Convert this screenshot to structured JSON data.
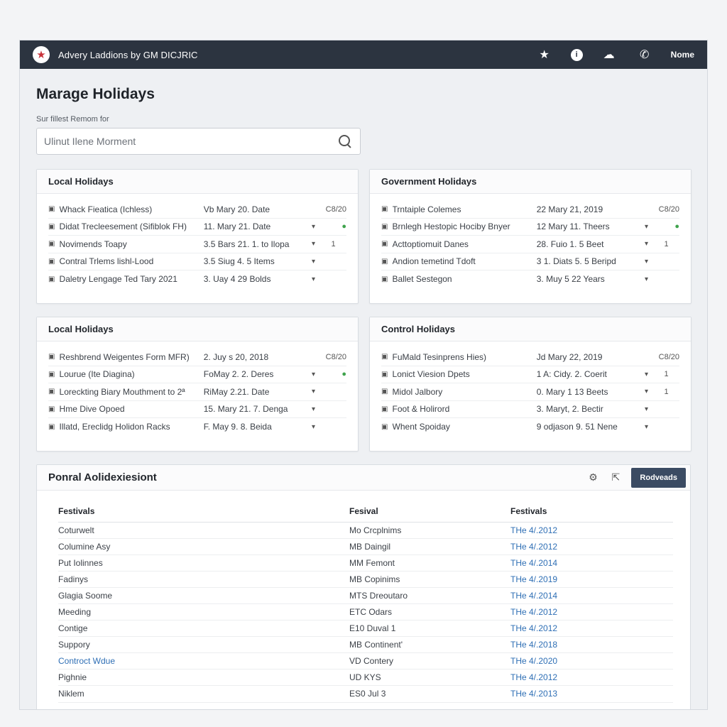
{
  "app": {
    "title": "Advery Laddions by GM DICJRIC",
    "user": "Nome"
  },
  "page": {
    "title": "Marage Holidays",
    "search_label": "Sur fillest Remom for",
    "search_placeholder": "Ulinut Ilene Morment"
  },
  "panels": [
    {
      "title": "Local Holidays",
      "rows": [
        {
          "name": "Whack Fieatica (Ichless)",
          "date": "Vb Mary 20. Date",
          "a": "",
          "b": "C8/20",
          "b_style": ""
        },
        {
          "name": "Didat Trecleesement (Sifiblok FH)",
          "date": "11. Mary 21. Date",
          "a": "▾",
          "b": "●",
          "b_style": "green"
        },
        {
          "name": "Novimends Toapy",
          "date": "3.5 Bars 21. 1. to Ilopa",
          "a": "▾",
          "b": "1",
          "b_style": "center"
        },
        {
          "name": "Contral Trlems lishl-Lood",
          "date": "3.5 Siug 4. 5 Items",
          "a": "▾",
          "b": "",
          "b_style": ""
        },
        {
          "name": "Daletry Lengage Ted Tary 2021",
          "date": "3. Uay 4 29 Bolds",
          "a": "▾",
          "b": "",
          "b_style": ""
        }
      ]
    },
    {
      "title": "Government Holidays",
      "rows": [
        {
          "name": "Trntaiple Colemes",
          "date": "22 Mary 21, 2019",
          "a": "",
          "b": "C8/20",
          "b_style": ""
        },
        {
          "name": "Brnlegh Hestopic Hociby Bnyer",
          "date": "12 Mary 11. Theers",
          "a": "▾",
          "b": "●",
          "b_style": "green"
        },
        {
          "name": "Acttoptiomuit Danes",
          "date": "28. Fuio 1. 5 Beet",
          "a": "▾",
          "b": "1",
          "b_style": "center"
        },
        {
          "name": "Andion temetind Tdoft",
          "date": "3 1. Diats 5. 5 Beripd",
          "a": "▾",
          "b": "",
          "b_style": ""
        },
        {
          "name": "Ballet Sestegon",
          "date": "3. Muy 5 22 Years",
          "a": "▾",
          "b": "",
          "b_style": ""
        }
      ]
    },
    {
      "title": "Local Holidays",
      "rows": [
        {
          "name": "Reshbrend Weigentes Form MFR)",
          "date": "2. Juy s 20, 2018",
          "a": "",
          "b": "C8/20",
          "b_style": ""
        },
        {
          "name": "Lourue (Ite Diagina)",
          "date": "FoMay 2. 2. Deres",
          "a": "▾",
          "b": "●",
          "b_style": "green"
        },
        {
          "name": "Loreckting Biary Mouthment to 2ª",
          "date": "RiMay 2.21. Date",
          "a": "▾",
          "b": "",
          "b_style": ""
        },
        {
          "name": "Hme Dive Opoed",
          "date": "15. Mary 21. 7. Denga",
          "a": "▾",
          "b": "",
          "b_style": ""
        },
        {
          "name": "Illatd, Ereclidg Holidon Racks",
          "date": "F. May 9. 8. Beida",
          "a": "▾",
          "b": "",
          "b_style": ""
        }
      ]
    },
    {
      "title": "Control Holidays",
      "rows": [
        {
          "name": "FuMald Tesinprens Hies)",
          "date": "Jd Mary 22, 2019",
          "a": "",
          "b": "C8/20",
          "b_style": ""
        },
        {
          "name": "Lonict Viesion Dpets",
          "date": "1 A: Cidy. 2. Coerit",
          "a": "▾",
          "b": "1",
          "b_style": "center"
        },
        {
          "name": "Midol Jalbory",
          "date": "0. Mary 1 13 Beets",
          "a": "▾",
          "b": "1",
          "b_style": "center"
        },
        {
          "name": "Foot & Holirord",
          "date": "3. Maryt, 2. Bectir",
          "a": "▾",
          "b": "",
          "b_style": ""
        },
        {
          "name": "Whent Spoiday",
          "date": "9 odjason 9. 51 Nene",
          "a": "▾",
          "b": "",
          "b_style": ""
        }
      ]
    }
  ],
  "festivals": {
    "title": "Ponral Aolidexiesiont",
    "button": "Rodveads",
    "headers": [
      "Festivals",
      "Fesival",
      "Festivals"
    ],
    "rows": [
      {
        "name": "Coturwelt",
        "code": "Mo Crcplnims",
        "date": "THe 4/.2012",
        "link": false
      },
      {
        "name": "Columine Asy",
        "code": "MB Daingil",
        "date": "THe 4/.2012",
        "link": false
      },
      {
        "name": "Put Iolinnes",
        "code": "MM Femont",
        "date": "THe 4/.2014",
        "link": false
      },
      {
        "name": "Fadinys",
        "code": "MB Copinims",
        "date": "THe 4/.2019",
        "link": false
      },
      {
        "name": "Glagia Soome",
        "code": "MTS Dreoutaro",
        "date": "THe 4/.2014",
        "link": false
      },
      {
        "name": "Meeding",
        "code": "ETC Odars",
        "date": "THe 4/.2012",
        "link": false
      },
      {
        "name": "Contige",
        "code": "E10 Duval 1",
        "date": "THe 4/.2012",
        "link": false
      },
      {
        "name": "Suppory",
        "code": "MB Continent'",
        "date": "THe 4/.2018",
        "link": false
      },
      {
        "name": "Controct Wdue",
        "code": "VD Contery",
        "date": "THe 4/.2020",
        "link": true
      },
      {
        "name": "Pighnie",
        "code": "UD KYS",
        "date": "THe 4/.2012",
        "link": false
      },
      {
        "name": "Niklem",
        "code": "ES0 Jul 3",
        "date": "THe 4/.2013",
        "link": false
      }
    ]
  },
  "colors": {
    "titlebar": "#2c3440",
    "accent_button": "#3b4b63",
    "link": "#2f6fb5",
    "status_green": "#3fa34d"
  },
  "icons": {
    "logo": "star-logo-icon",
    "titlebar": [
      "star-icon",
      "info-icon",
      "cloud-icon",
      "phone-icon"
    ],
    "festival_actions": [
      "settings-icon",
      "export-icon"
    ]
  }
}
